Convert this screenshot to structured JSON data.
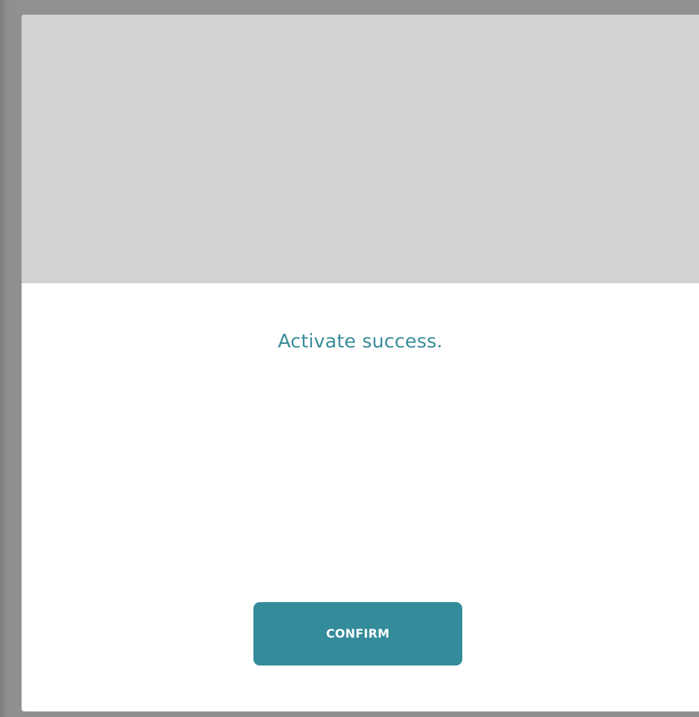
{
  "dialog": {
    "message": "Activate success.",
    "confirm_label": "CONFIRM"
  },
  "colors": {
    "accent": "#348c9b",
    "message_text": "#378c9a",
    "header_placeholder": "#d3d3d3",
    "overlay": "#909090"
  }
}
